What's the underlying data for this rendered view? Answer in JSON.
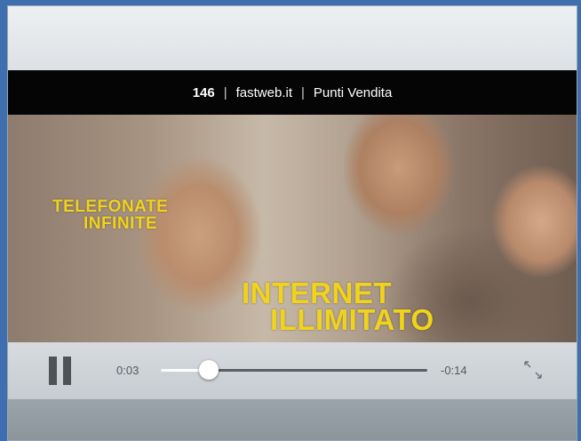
{
  "video": {
    "header": {
      "number": "146",
      "site": "fastweb.it",
      "stores": "Punti Vendita",
      "separator": "|"
    },
    "overlay": {
      "line1a": "TELEFONATE",
      "line1b": "INFINITE",
      "line2a": "INTERNET",
      "line2b": "ILLIMITATO"
    }
  },
  "player": {
    "elapsed": "0:03",
    "remaining": "-0:14",
    "progress": 0.18,
    "pause_icon": "pause-icon",
    "fullscreen_icon": "fullscreen-icon"
  },
  "colors": {
    "header_bg": "#050505",
    "overlay_text": "#f0d31a",
    "controls_bg": "#d0d4d8",
    "page_bg": "#3f6fae"
  }
}
